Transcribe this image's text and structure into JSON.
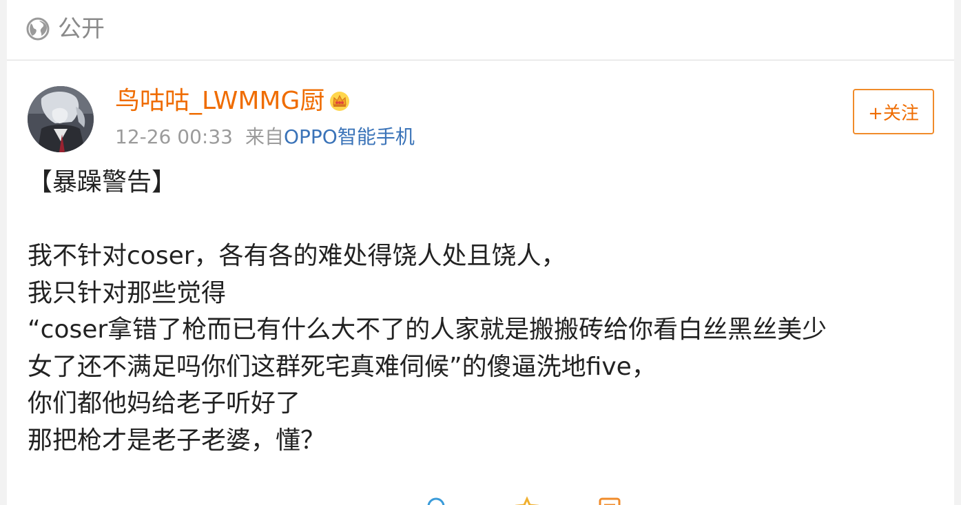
{
  "visibility": {
    "label": "公开",
    "icon": "globe-icon"
  },
  "post": {
    "author": {
      "name": "鸟咕咕_LWMMG厨",
      "badge_icon": "crown-icon"
    },
    "timestamp": "12-26 00:33",
    "source_prefix": "来自",
    "source_device": "OPPO智能手机",
    "follow_label": "+关注",
    "body_lines": [
      "【暴躁警告】",
      "",
      "我不针对coser，各有各的难处得饶人处且饶人，",
      "我只针对那些觉得",
      "“coser拿错了枪而已有什么大不了的人家就是搬搬砖给你看白丝黑丝美少",
      "女了还不满足吗你们这群死宅真难伺候”的傻逼洗地five，",
      "你们都他妈给老子听好了",
      "那把枪才是老子老婆，懂？"
    ]
  },
  "actions": {
    "icons": [
      "search-icon",
      "like-icon",
      "comment-icon"
    ]
  },
  "colors": {
    "accent": "#ef6c00",
    "link": "#3a73b8",
    "meta": "#9b9b9b",
    "text": "#222222"
  }
}
